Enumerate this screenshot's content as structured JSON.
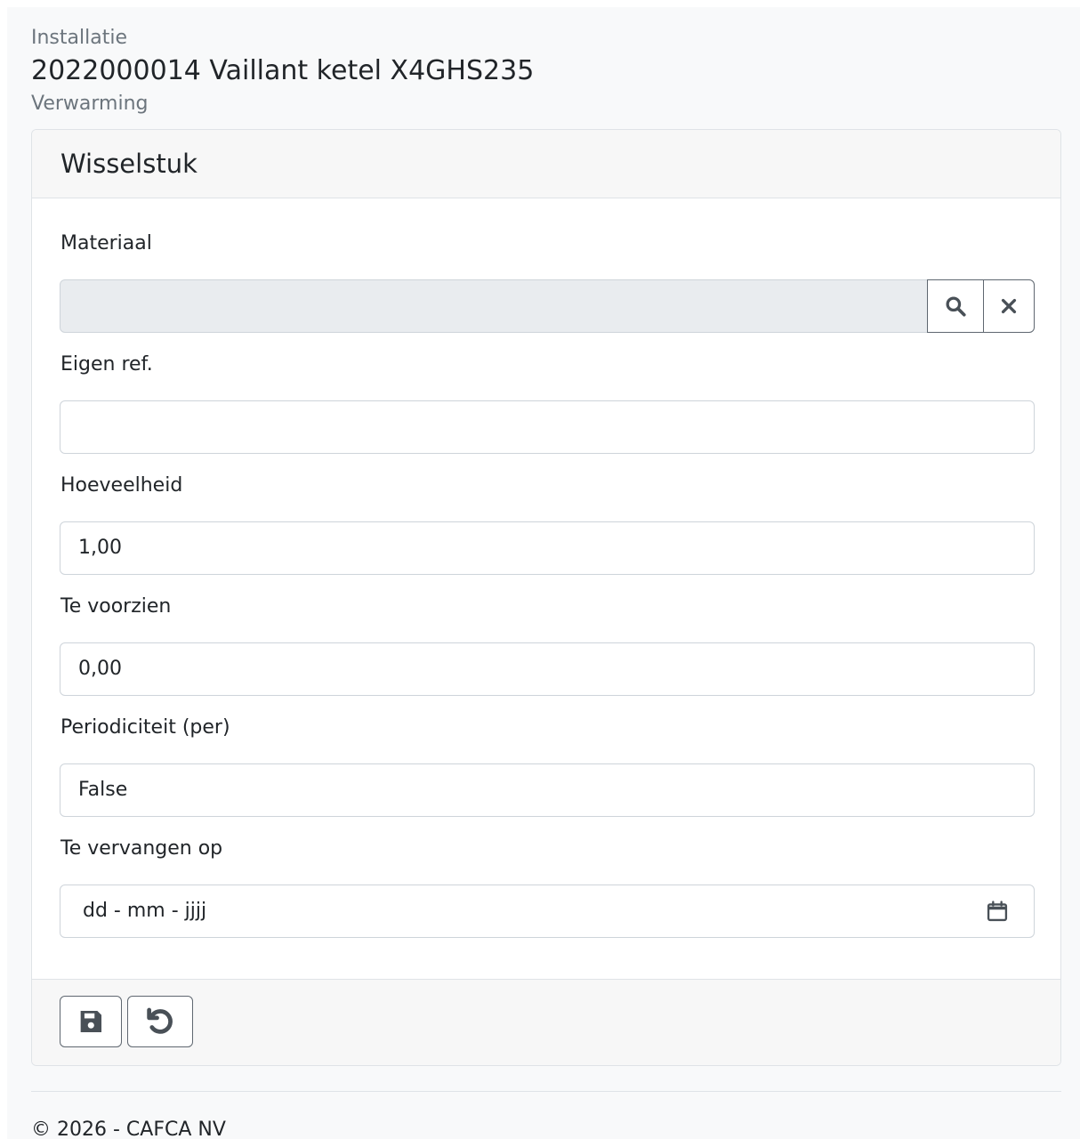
{
  "breadcrumb": {
    "section": "Installatie",
    "title": "2022000014 Vaillant ketel X4GHS235",
    "category": "Verwarming"
  },
  "card": {
    "title": "Wisselstuk",
    "fields": {
      "materiaal": {
        "label": "Materiaal",
        "value": ""
      },
      "eigen_ref": {
        "label": "Eigen ref.",
        "value": ""
      },
      "hoeveelheid": {
        "label": "Hoeveelheid",
        "value": "1,00"
      },
      "te_voorzien": {
        "label": "Te voorzien",
        "value": "0,00"
      },
      "periodiciteit": {
        "label": "Periodiciteit (per)",
        "value": "False"
      },
      "te_vervangen_op": {
        "label": "Te vervangen op",
        "placeholder": "dd - mm - jjjj"
      }
    }
  },
  "icons": {
    "search": "search-icon",
    "clear": "close-icon",
    "calendar": "calendar-icon",
    "save": "save-icon",
    "reset": "undo-icon"
  },
  "footer": {
    "copyright": "© 2026 - CAFCA NV"
  },
  "colors": {
    "page_background": "#f8f9fa",
    "card_background": "#ffffff",
    "border": "#dfe3e7",
    "muted_text": "#6c757d",
    "disabled_background": "#e9ecef",
    "button_border": "#5f6770"
  }
}
